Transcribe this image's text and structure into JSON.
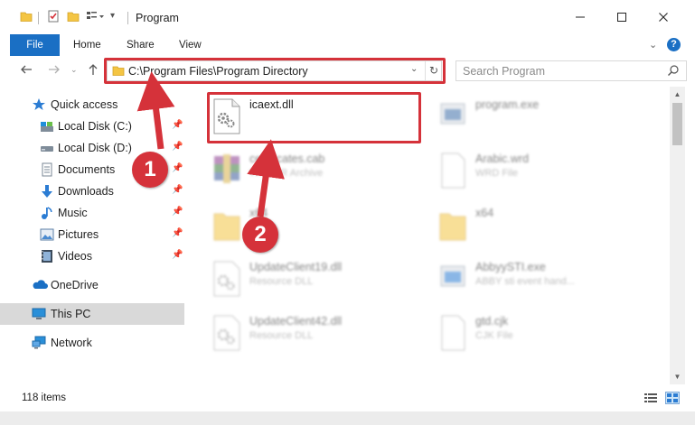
{
  "window": {
    "title": "Program",
    "controls": [
      "minimize-icon",
      "maximize-icon",
      "close-icon"
    ]
  },
  "ribbon": {
    "tabs": [
      "File",
      "Home",
      "Share",
      "View"
    ],
    "help": "?"
  },
  "nav": {
    "address_path": "C:\\Program Files\\Program Directory",
    "search_placeholder": "Search Program"
  },
  "sidebar": {
    "items": [
      {
        "label": "Quick access",
        "icon": "star-icon"
      },
      {
        "label": "Local Disk (C:)",
        "icon": "drive-icon",
        "pinned": true
      },
      {
        "label": "Local Disk (D:)",
        "icon": "drive-icon",
        "pinned": true
      },
      {
        "label": "Documents",
        "icon": "documents-icon",
        "pinned": true
      },
      {
        "label": "Downloads",
        "icon": "downloads-icon",
        "pinned": true
      },
      {
        "label": "Music",
        "icon": "music-icon",
        "pinned": true
      },
      {
        "label": "Pictures",
        "icon": "pictures-icon",
        "pinned": true
      },
      {
        "label": "Videos",
        "icon": "videos-icon",
        "pinned": true
      },
      {
        "label": "OneDrive",
        "icon": "cloud-icon"
      },
      {
        "label": "This PC",
        "icon": "computer-icon",
        "selected": true
      },
      {
        "label": "Network",
        "icon": "network-icon"
      }
    ]
  },
  "files": [
    {
      "name": "icaext.dll",
      "type": "",
      "icon": "dll-gear-icon",
      "highlighted": true
    },
    {
      "name": "program.exe",
      "type": "",
      "icon": "exe-icon"
    },
    {
      "name": "certificates.cab",
      "type": "WinRAR Archive",
      "icon": "winrar-icon"
    },
    {
      "name": "Arabic.wrd",
      "type": "WRD File",
      "icon": "blank-file-icon"
    },
    {
      "name": "x64",
      "type": "",
      "icon": "folder-icon"
    },
    {
      "name": "x64",
      "type": "",
      "icon": "folder-icon"
    },
    {
      "name": "UpdateClient19.dll",
      "type": "Resource DLL",
      "icon": "dll-gear-icon"
    },
    {
      "name": "AbbyySTI.exe",
      "type": "ABBY sti event hand...",
      "icon": "exe-icon"
    },
    {
      "name": "UpdateClient42.dll",
      "type": "Resource DLL",
      "icon": "dll-gear-icon"
    },
    {
      "name": "gtd.cjk",
      "type": "CJK File",
      "icon": "blank-file-icon"
    }
  ],
  "status": {
    "item_count": "118 items"
  },
  "annotations": {
    "callout_1": "1",
    "callout_2": "2",
    "highlight_color": "#d5323a"
  },
  "colors": {
    "accent": "#1a6fc4",
    "selection": "#d9d9d9",
    "annotation_red": "#d5323a"
  }
}
